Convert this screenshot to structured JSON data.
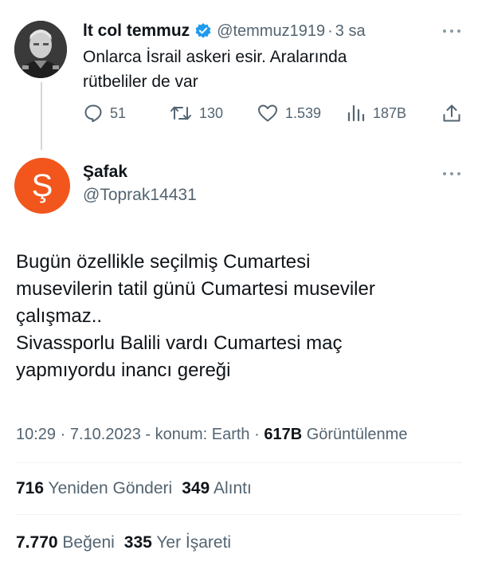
{
  "parent_tweet": {
    "author_name": "lt col temmuz",
    "verified": true,
    "handle": "@temmuz1919",
    "separator": "·",
    "time": "3 sa",
    "text_lines": [
      "Onlarca İsrail askeri esir. Aralarında",
      "rütbeliler de var"
    ],
    "actions": {
      "replies": "51",
      "reposts": "130",
      "likes": "1.539",
      "views": "187B"
    },
    "icons": [
      "more-icon",
      "reply-icon",
      "repost-icon",
      "like-icon",
      "views-icon",
      "share-icon"
    ]
  },
  "main_tweet": {
    "author_name": "Şafak",
    "avatar_letter": "Ş",
    "avatar_color": "#f2561d",
    "handle": "@Toprak14431",
    "text_lines": [
      "Bugün özellikle seçilmiş Cumartesi",
      "musevilerin tatil günü Cumartesi museviler",
      "çalışmaz..",
      "Sivassporlu Balili vardı Cumartesi maç",
      "yapmıyordu inancı gereği"
    ],
    "meta": {
      "time": "10:29",
      "date": "7.10.2023",
      "location": "konum: Earth",
      "views_count": "617B",
      "views_label": "Görüntülenme"
    },
    "stats": {
      "reposts_count": "716",
      "reposts_label": "Yeniden Gönderi",
      "quotes_count": "349",
      "quotes_label": "Alıntı",
      "likes_count": "7.770",
      "likes_label": "Beğeni",
      "bookmarks_count": "335",
      "bookmarks_label": "Yer İşareti"
    }
  },
  "colors": {
    "text": "#0f1419",
    "secondary": "#536471",
    "verified_blue": "#1d9bf0",
    "divider": "#eff3f4"
  }
}
